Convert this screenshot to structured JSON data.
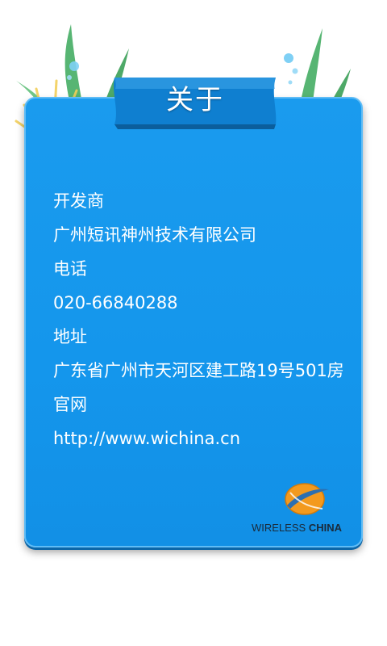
{
  "page": {
    "title": "关于"
  },
  "info": {
    "developer_label": "开发商",
    "developer_value": "广州短讯神州技术有限公司",
    "phone_label": "电话",
    "phone_value": "020-66840288",
    "address_label": "地址",
    "address_value": "广东省广州市天河区建工路19号501房",
    "website_label": "官网",
    "website_value": "http://www.wichina.cn"
  },
  "logo": {
    "name_regular": "WIRELESS",
    "name_bold": "CHINA"
  },
  "colors": {
    "card_background": "#1496ec",
    "banner_background": "#0f7fd0",
    "text": "#ffffff",
    "logo_orange": "#f39a1e"
  }
}
